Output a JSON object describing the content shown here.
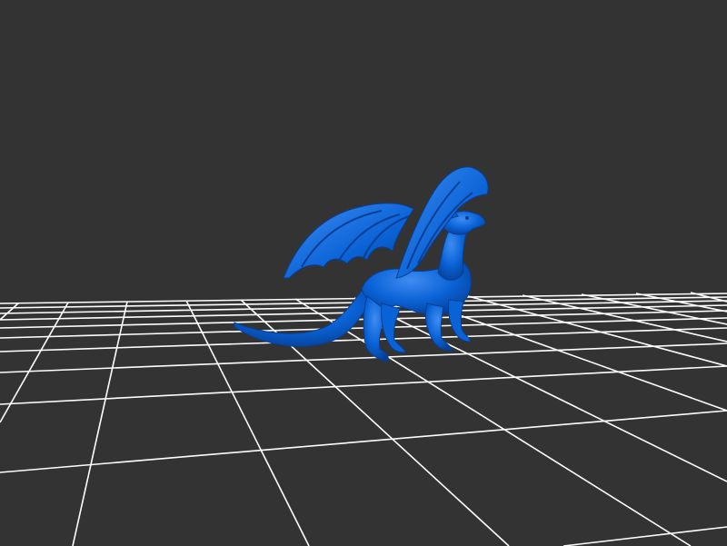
{
  "scene": {
    "background_color": "#333333",
    "grid_color": "#ffffff",
    "model_color": "#0a63d6",
    "model_shadow_color": "#063f96",
    "model_highlight_color": "#3f8cf2",
    "model_name": "dragon"
  }
}
